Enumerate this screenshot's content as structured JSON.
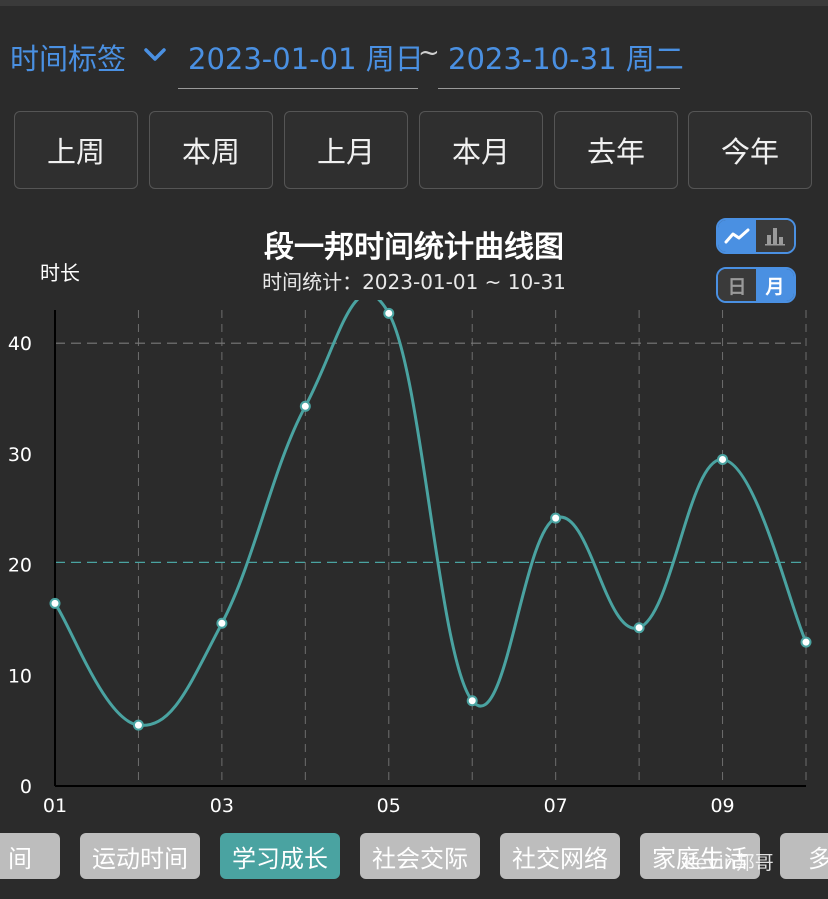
{
  "header": {
    "tag_label": "时间标签",
    "start_date": "2023-01-01 周日",
    "separator": "~",
    "end_date": "2023-10-31 周二"
  },
  "period_buttons": [
    "上周",
    "本周",
    "上月",
    "本月",
    "去年",
    "今年"
  ],
  "chart_type_toggle": {
    "options": [
      "line-chart-icon",
      "bar-chart-icon"
    ],
    "selected": "line-chart-icon"
  },
  "granularity_toggle": {
    "options": [
      "日",
      "月"
    ],
    "selected": "月"
  },
  "chart_data": {
    "type": "line",
    "title": "段一邦时间统计曲线图",
    "subtitle": "时间统计：2023-01-01 ~ 10-31",
    "ylabel": "时长",
    "xlabel": "",
    "x_ticks": [
      "01",
      "03",
      "05",
      "07",
      "09"
    ],
    "x": [
      "01",
      "02",
      "03",
      "04",
      "05",
      "06",
      "07",
      "08",
      "09",
      "10"
    ],
    "ylim": [
      0,
      43
    ],
    "y_ticks": [
      0,
      10,
      20,
      30,
      40
    ],
    "series": [
      {
        "values": [
          16.5,
          5.5,
          14.7,
          34.3,
          42.7,
          7.7,
          24.2,
          14.3,
          29.5,
          13.0
        ],
        "color": "#4aa3a1"
      }
    ],
    "reference_lines": [
      {
        "value": 40,
        "color": "#7a7a7a"
      },
      {
        "value": 20.2,
        "color": "#4aa3a1"
      }
    ],
    "grid": true
  },
  "categories": {
    "items": [
      "间",
      "运动时间",
      "学习成长",
      "社会交际",
      "社交网络",
      "家庭生活",
      "多"
    ],
    "active": "学习成长"
  },
  "watermark": "Kevin邦哥"
}
